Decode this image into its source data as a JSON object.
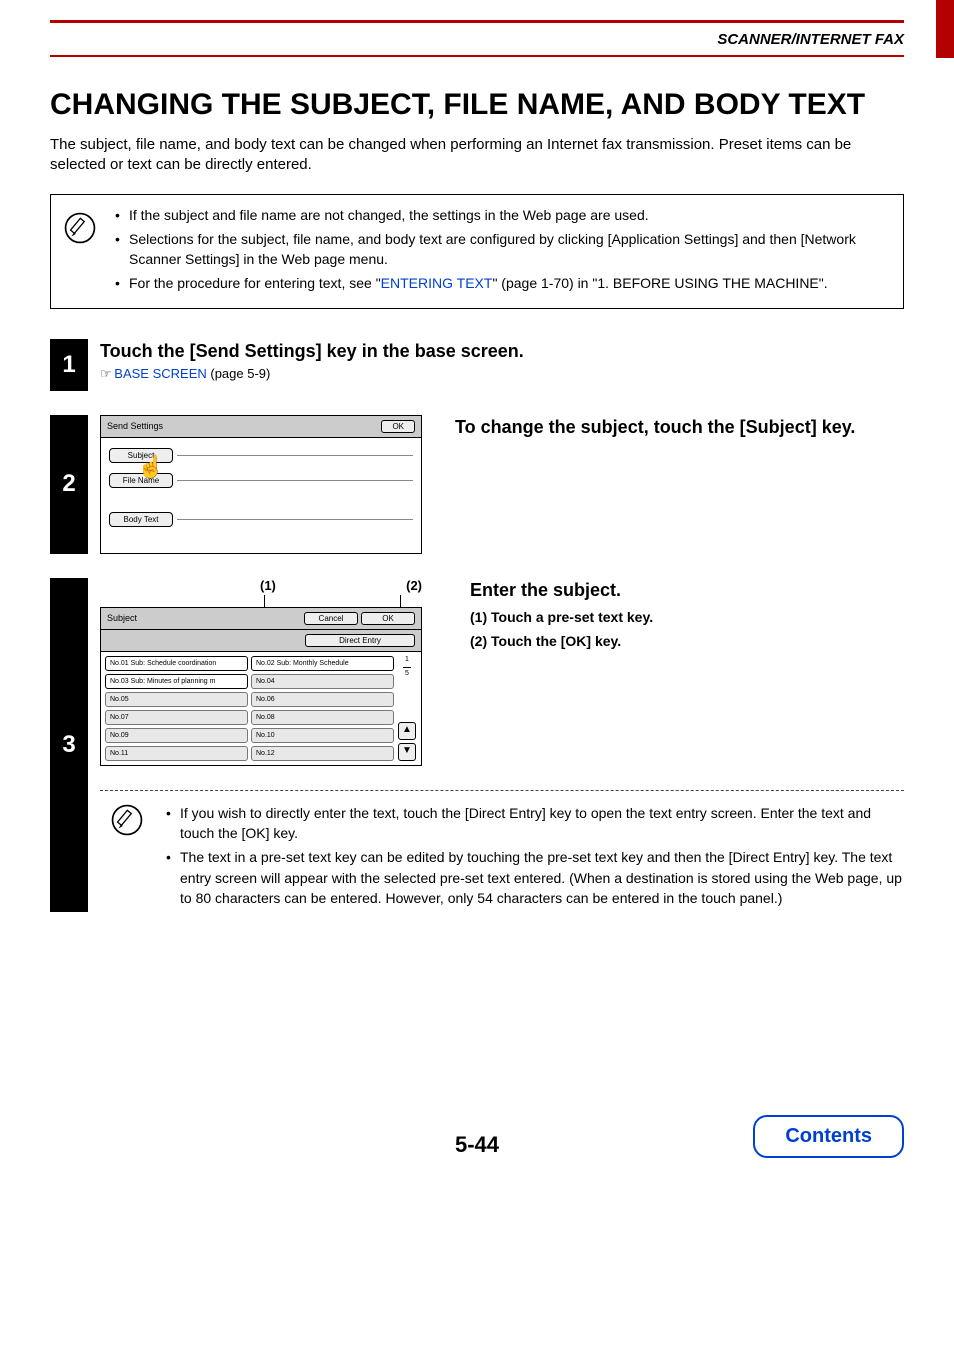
{
  "header": {
    "section": "SCANNER/INTERNET FAX"
  },
  "title": "CHANGING THE SUBJECT, FILE NAME, AND BODY TEXT",
  "intro": "The subject, file name, and body text can be changed when performing an Internet fax transmission. Preset items can be selected or text can be directly entered.",
  "info": {
    "b1": "If the subject and file name are not changed, the settings in the Web page are used.",
    "b2": "Selections for the subject, file name, and body text are configured by clicking [Application Settings] and then [Network Scanner Settings] in the Web page menu.",
    "b3_pre": "For the procedure for entering text, see \"",
    "b3_link": "ENTERING TEXT",
    "b3_post": "\" (page 1-70) in \"1. BEFORE USING THE MACHINE\"."
  },
  "step1": {
    "num": "1",
    "title": "Touch the [Send Settings] key in the base screen.",
    "ref_link": "BASE SCREEN",
    "ref_post": " (page 5-9)"
  },
  "step2": {
    "num": "2",
    "panel_title": "Send Settings",
    "ok": "OK",
    "subject": "Subject",
    "file_name": "File Name",
    "body_text": "Body Text",
    "right_title": "To change the subject, touch the [Subject] key."
  },
  "step3": {
    "num": "3",
    "callout1": "(1)",
    "callout2": "(2)",
    "panel_title": "Subject",
    "cancel": "Cancel",
    "ok": "OK",
    "direct": "Direct Entry",
    "presets": {
      "left": [
        "No.01 Sub: Schedule coordination",
        "No.03 Sub: Minutes of planning m",
        "No.05",
        "No.07",
        "No.09",
        "No.11"
      ],
      "right": [
        "No.02 Sub: Monthly Schedule",
        "No.04",
        "No.06",
        "No.08",
        "No.10",
        "No.12"
      ]
    },
    "frac_top": "1",
    "frac_bot": "5",
    "right_title": "Enter the subject.",
    "sub1": "(1)  Touch a pre-set text key.",
    "sub2": "(2)  Touch the [OK] key.",
    "note1": "If you wish to directly enter the text, touch the [Direct Entry] key to open the text entry screen. Enter the text and touch the [OK] key.",
    "note2": "The text in a pre-set text key can be edited by touching the pre-set text key and then the [Direct Entry] key. The text entry screen will appear with the selected pre-set text entered. (When a destination is stored using the Web page, up to 80 characters can be entered. However, only 54 characters can be entered in the touch panel.)"
  },
  "page_num": "5-44",
  "contents": "Contents"
}
